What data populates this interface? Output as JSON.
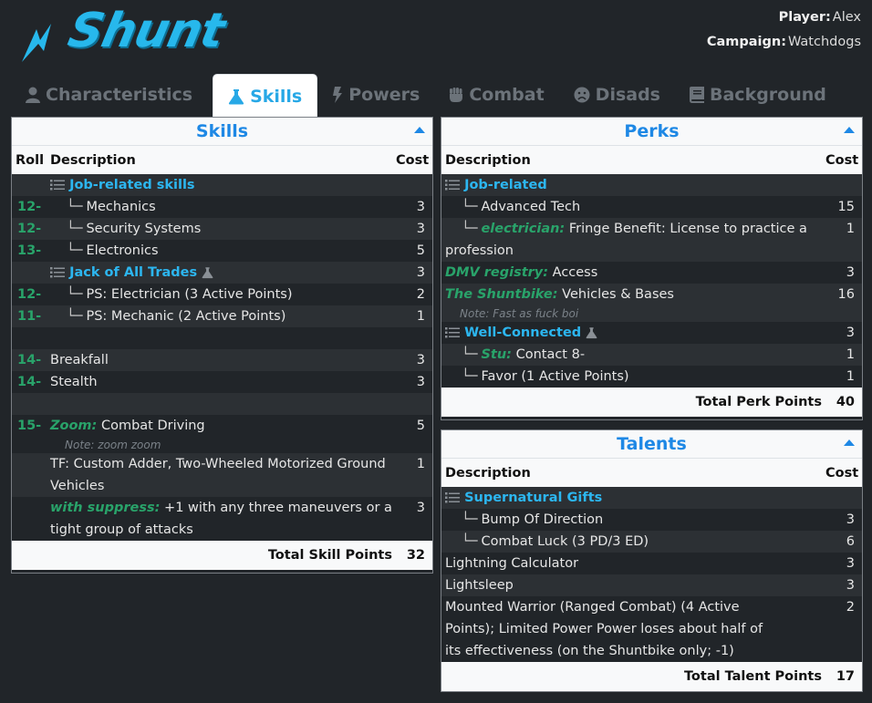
{
  "app": {
    "logo_text": "Shunt"
  },
  "player": {
    "player_label": "Player:",
    "player_value": "Alex",
    "campaign_label": "Campaign:",
    "campaign_value": "Watchdogs"
  },
  "tabs": [
    {
      "label": "Characteristics",
      "icon": "user-icon"
    },
    {
      "label": "Skills",
      "icon": "flask-icon",
      "active": true
    },
    {
      "label": "Powers",
      "icon": "bolt-icon"
    },
    {
      "label": "Combat",
      "icon": "fist-icon"
    },
    {
      "label": "Disads",
      "icon": "frown-icon"
    },
    {
      "label": "Background",
      "icon": "book-icon"
    }
  ],
  "skills": {
    "title": "Skills",
    "headers": {
      "roll": "Roll",
      "description": "Description",
      "cost": "Cost"
    },
    "rows": [
      {
        "roll": "",
        "group": "Job-related skills",
        "cost": ""
      },
      {
        "roll": "12-",
        "desc": "Mechanics",
        "cost": "3"
      },
      {
        "roll": "12-",
        "desc": "Security Systems",
        "cost": "3"
      },
      {
        "roll": "13-",
        "desc": "Electronics",
        "cost": "5"
      },
      {
        "roll": "",
        "group": "Jack of All Trades",
        "cost": "3"
      },
      {
        "roll": "12-",
        "desc": "PS: Electrician (3 Active Points)",
        "cost": "2"
      },
      {
        "roll": "11-",
        "desc": "PS: Mechanic (2 Active Points)",
        "cost": "1"
      },
      {
        "roll": "14-",
        "desc": "Breakfall",
        "cost": "3"
      },
      {
        "roll": "14-",
        "desc": "Stealth",
        "cost": "3"
      },
      {
        "roll": "15-",
        "adder": "Zoom:",
        "desc": "Combat Driving",
        "cost": "5",
        "note": "Note: zoom zoom"
      },
      {
        "roll": "",
        "desc": "TF: Custom Adder, Two-Wheeled Motorized Ground Vehicles",
        "cost": "1"
      },
      {
        "roll": "",
        "adder": "with suppress:",
        "desc": "+1 with any three maneuvers or a tight group of attacks",
        "cost": "3"
      }
    ],
    "total_label": "Total Skill Points",
    "total_value": "32"
  },
  "perks": {
    "title": "Perks",
    "headers": {
      "description": "Description",
      "cost": "Cost"
    },
    "rows": [
      {
        "group": "Job-related",
        "cost": ""
      },
      {
        "desc": "Advanced Tech",
        "cost": "15"
      },
      {
        "adder": "electrician:",
        "desc": "Fringe Benefit: License to practice a profession",
        "cost": "1"
      },
      {
        "adder": "DMV registry:",
        "desc": "Access",
        "cost": "3"
      },
      {
        "adder": "The Shuntbike:",
        "desc": "Vehicles & Bases",
        "cost": "16",
        "note": "Note: Fast as fuck boi"
      },
      {
        "group": "Well-Connected",
        "cost": "3"
      },
      {
        "adder": "Stu:",
        "desc": "Contact 8-",
        "cost": "1"
      },
      {
        "desc": "Favor (1 Active Points)",
        "cost": "1"
      }
    ],
    "total_label": "Total Perk Points",
    "total_value": "40"
  },
  "talents": {
    "title": "Talents",
    "headers": {
      "description": "Description",
      "cost": "Cost"
    },
    "rows": [
      {
        "group": "Supernatural Gifts",
        "cost": ""
      },
      {
        "desc": "Bump Of Direction",
        "cost": "3"
      },
      {
        "desc": "Combat Luck (3 PD/3 ED)",
        "cost": "6"
      },
      {
        "desc": "Lightning Calculator",
        "cost": "3"
      },
      {
        "desc": "Lightsleep",
        "cost": "3"
      },
      {
        "desc": "Mounted Warrior (Ranged Combat) (4 Active Points); Limited Power Power loses about half of its effectiveness (on the Shuntbike only; -1)",
        "cost": "2"
      }
    ],
    "total_label": "Total Talent Points",
    "total_value": "17"
  }
}
